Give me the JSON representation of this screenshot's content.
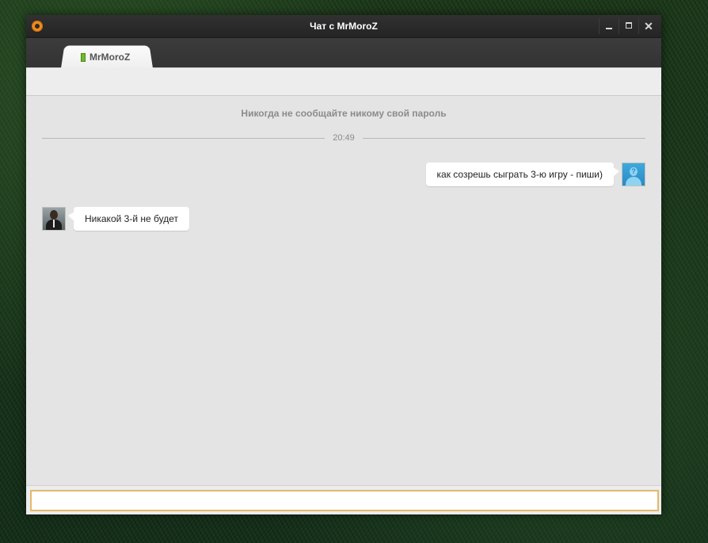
{
  "window": {
    "title": "Чат с MrMoroZ",
    "controls": {
      "minimize": "",
      "maximize": "",
      "close": "✕"
    }
  },
  "tabs": [
    {
      "label": "MrMoroZ",
      "status": "online",
      "status_color": "#6fba2c"
    }
  ],
  "chat": {
    "security_notice": "Никогда не сообщайте никому свой пароль",
    "timestamp": "20:49",
    "messages": [
      {
        "direction": "outgoing",
        "text": "как созрешь сыграть 3-ю игру - пиши)",
        "avatar": "default-user-avatar-icon"
      },
      {
        "direction": "incoming",
        "text": "Никакой 3-й не будет",
        "avatar": "contact-avatar"
      }
    ]
  },
  "input": {
    "value": "",
    "placeholder": "",
    "focus_color": "#e2b96a"
  },
  "colors": {
    "accent": "#f08b1d",
    "titlebar": "#2b2b2b",
    "background": "#e4e4e4"
  }
}
